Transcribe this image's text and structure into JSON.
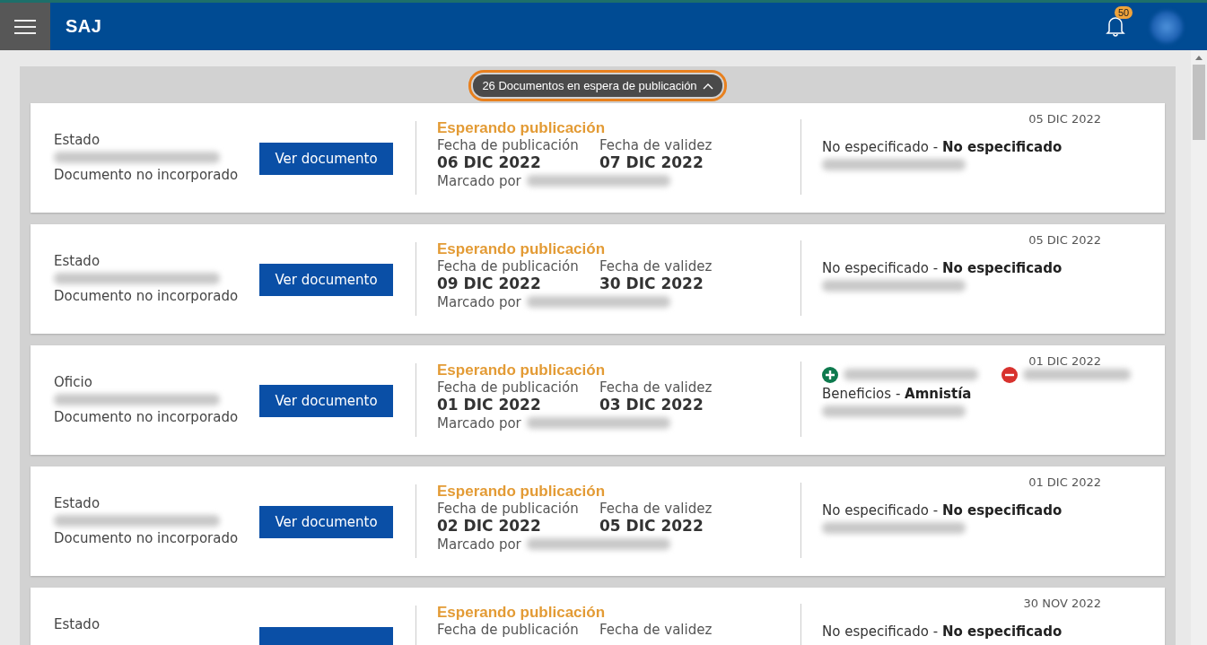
{
  "header": {
    "title": "SAJ",
    "notification_count": "50"
  },
  "banner": {
    "label": "26 Documentos en espera de publicación"
  },
  "documents": [
    {
      "type": "Estado",
      "incorporation": "Documento no incorporado",
      "button": "Ver documento",
      "status": "Esperando publicación",
      "pub_label": "Fecha de publicación",
      "pub_date": "06 DIC 2022",
      "valid_label": "Fecha de validez",
      "valid_date": "07 DIC 2022",
      "marked_label": "Marcado por",
      "date": "05 DIC 2022",
      "kind": "plain",
      "category": "No especificado - **No especificado**"
    },
    {
      "type": "Estado",
      "incorporation": "Documento no incorporado",
      "button": "Ver documento",
      "status": "Esperando publicación",
      "pub_label": "Fecha de publicación",
      "pub_date": "09 DIC 2022",
      "valid_label": "Fecha de validez",
      "valid_date": "30 DIC 2022",
      "marked_label": "Marcado por",
      "date": "05 DIC 2022",
      "kind": "plain",
      "category": "No especificado - **No especificado**"
    },
    {
      "type": "Oficio",
      "incorporation": "Documento no incorporado",
      "button": "Ver documento",
      "status": "Esperando publicación",
      "pub_label": "Fecha de publicación",
      "pub_date": "01 DIC 2022",
      "valid_label": "Fecha de validez",
      "valid_date": "03 DIC 2022",
      "marked_label": "Marcado por",
      "date": "01 DIC 2022",
      "kind": "benefit",
      "category": "Beneficios - **Amnistía**"
    },
    {
      "type": "Estado",
      "incorporation": "Documento no incorporado",
      "button": "Ver documento",
      "status": "Esperando publicación",
      "pub_label": "Fecha de publicación",
      "pub_date": "02 DIC 2022",
      "valid_label": "Fecha de validez",
      "valid_date": "05 DIC 2022",
      "marked_label": "Marcado por",
      "date": "01 DIC 2022",
      "kind": "plain",
      "category": "No especificado - **No especificado**"
    },
    {
      "type": "Estado",
      "status": "Esperando publicación",
      "pub_label": "Fecha de publicación",
      "valid_label": "Fecha de validez",
      "date": "30 NOV 2022",
      "kind": "plain",
      "category": "No especificado - **No especificado**"
    }
  ]
}
